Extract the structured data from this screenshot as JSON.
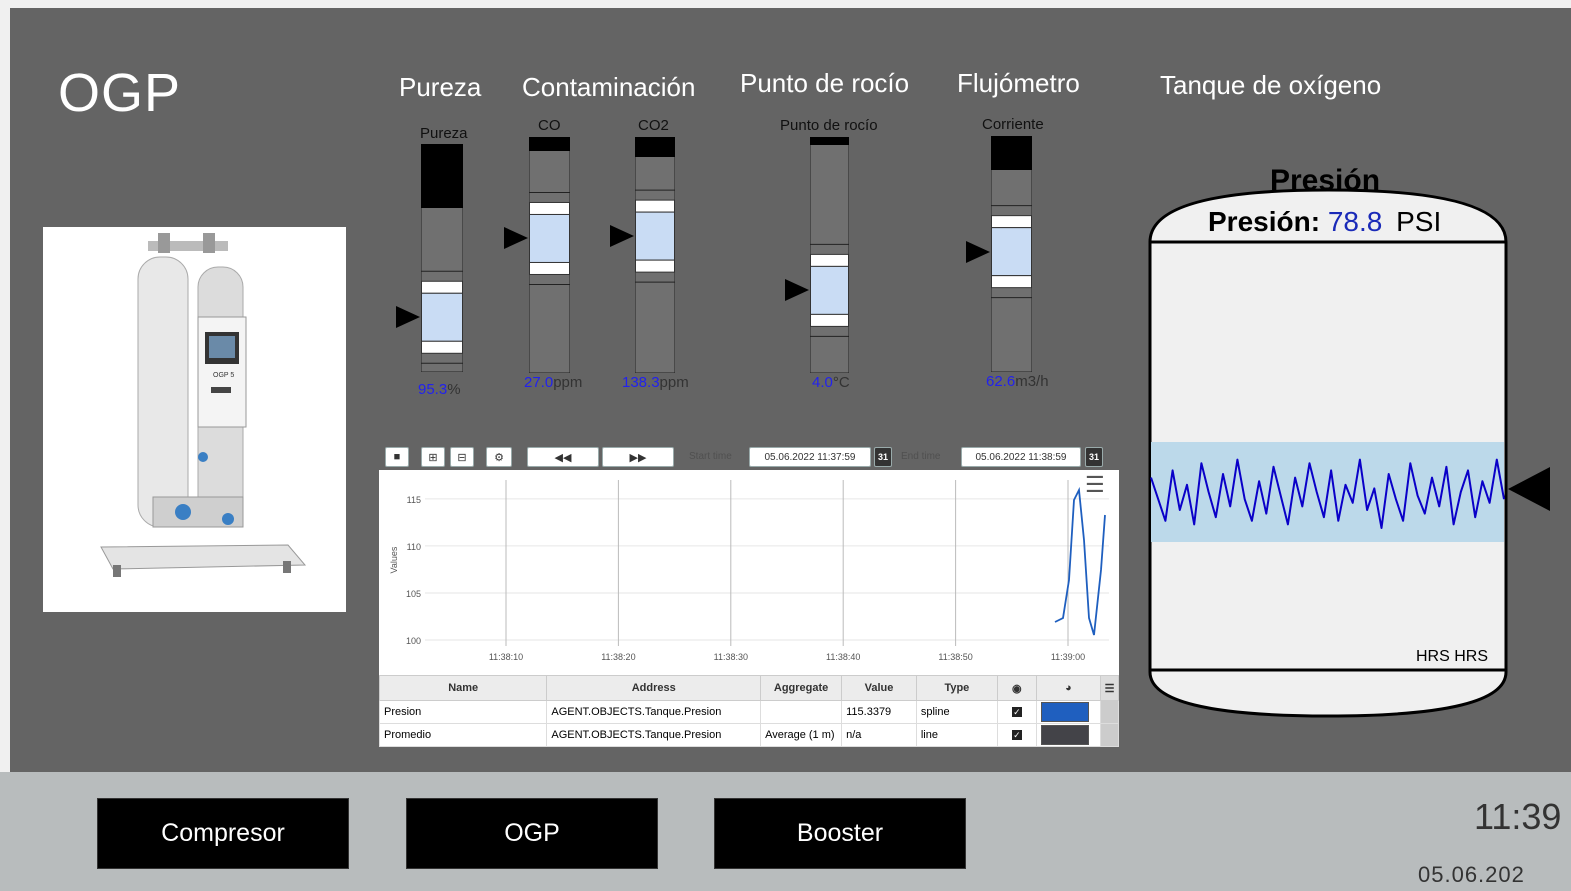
{
  "app": {
    "title": "OGP"
  },
  "product_image": {
    "model_label": "OGP 5"
  },
  "sections": {
    "pureza": "Pureza",
    "contaminacion": "Contaminación",
    "punto_rocio": "Punto de rocío",
    "flujometro": "Flujómetro",
    "tanque": "Tanque de oxígeno"
  },
  "gauges": [
    {
      "id": "pureza",
      "label": "Pureza",
      "value": "95.3",
      "unit": "%",
      "level": 0.24
    },
    {
      "id": "co",
      "label": "CO",
      "value": "27.0",
      "unit": "ppm",
      "level": 0.57
    },
    {
      "id": "co2",
      "label": "CO2",
      "value": "138.3",
      "unit": "ppm",
      "level": 0.58
    },
    {
      "id": "rocio",
      "label": "Punto de rocío",
      "value": "4.0",
      "unit": "°C",
      "level": 0.35
    },
    {
      "id": "corriente",
      "label": "Corriente",
      "value": "62.6",
      "unit": "m3/h",
      "level": 0.51
    }
  ],
  "trend": {
    "start_label": "Start time",
    "end_label": "End time",
    "start_time": "05.06.2022 11:37:59",
    "end_time": "05.06.2022 11:38:59",
    "calendar_icon_text": "31",
    "y_axis_title": "Values",
    "y_ticks": [
      "115",
      "110",
      "105",
      "100"
    ],
    "x_ticks": [
      "11:38:10",
      "11:38:20",
      "11:38:30",
      "11:38:40",
      "11:38:50",
      "11:39:00"
    ],
    "columns": [
      "Name",
      "Address",
      "Aggregate",
      "Value",
      "Type"
    ],
    "rows": [
      {
        "name": "Presion",
        "address": "AGENT.OBJECTS.Tanque.Presion",
        "aggregate": "",
        "value": "115.3379",
        "type": "spline",
        "visible": true,
        "color": "#1f5fbf"
      },
      {
        "name": "Promedio",
        "address": "AGENT.OBJECTS.Tanque.Presion",
        "aggregate": "Average (1 m)",
        "value": "n/a",
        "type": "line",
        "visible": true,
        "color": "#434348"
      }
    ]
  },
  "tank": {
    "title": "Presión",
    "pressure_label": "Presión:",
    "pressure_value": "78.8",
    "pressure_unit": "PSI",
    "axis_label": "HRS HRS",
    "band_color": "#bcd9ea",
    "line_color": "#0a00c8"
  },
  "nav": {
    "buttons": [
      "Compresor",
      "OGP",
      "Booster"
    ]
  },
  "status": {
    "time": "11:39",
    "date": "05.06.202"
  },
  "colors": {
    "background": "#646464",
    "footer": "#b8bcbd",
    "gauge_fill": "#c9dcf4",
    "value_blue": "#2222ee"
  }
}
